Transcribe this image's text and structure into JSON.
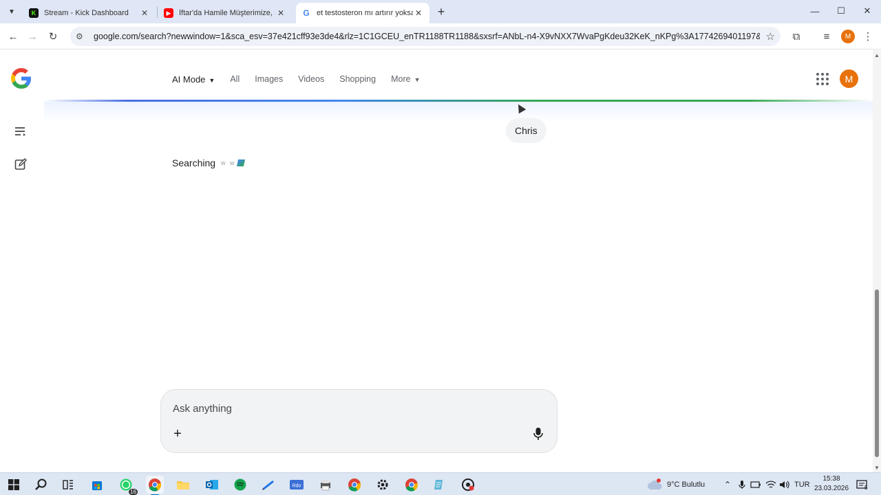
{
  "browser": {
    "tabs": [
      {
        "title": "Stream - Kick Dashboard",
        "favicon": "kick-icon",
        "active": false
      },
      {
        "title": "İftar'da Hamile Müşterimize, Şe",
        "favicon": "youtube-icon",
        "active": false
      },
      {
        "title": "et testosteron mı artırır yoksa d",
        "favicon": "google-icon",
        "active": true
      }
    ],
    "new_tab_label": "+",
    "address": "google.com/search?newwindow=1&sca_esv=37e421cff93e3de4&rlz=1C1GCEU_enTR1188TR1188&sxsrf=ANbL-n4-X9vNXX7WvaPgKdeu32KeK_nKPg%3A1774269401197&q=et+testoster...",
    "profile_initial": "M"
  },
  "google": {
    "nav": {
      "ai_mode": "AI Mode",
      "all": "All",
      "images": "Images",
      "videos": "Videos",
      "shopping": "Shopping",
      "more": "More"
    },
    "profile_initial": "M",
    "user_message": "Chris",
    "status": "Searching",
    "status_dots": "w w",
    "ask": {
      "placeholder": "Ask anything",
      "plus": "+"
    }
  },
  "taskbar": {
    "whatsapp_badge": "16",
    "weather": "9°C Bulutlu",
    "weather_alert": "3",
    "language": "TUR",
    "time": "15:38",
    "date": "23.03.2026",
    "notifications": "5"
  },
  "colors": {
    "accent_blue": "#4285f4",
    "accent_green": "#34a853",
    "avatar_orange": "#e8710a"
  }
}
